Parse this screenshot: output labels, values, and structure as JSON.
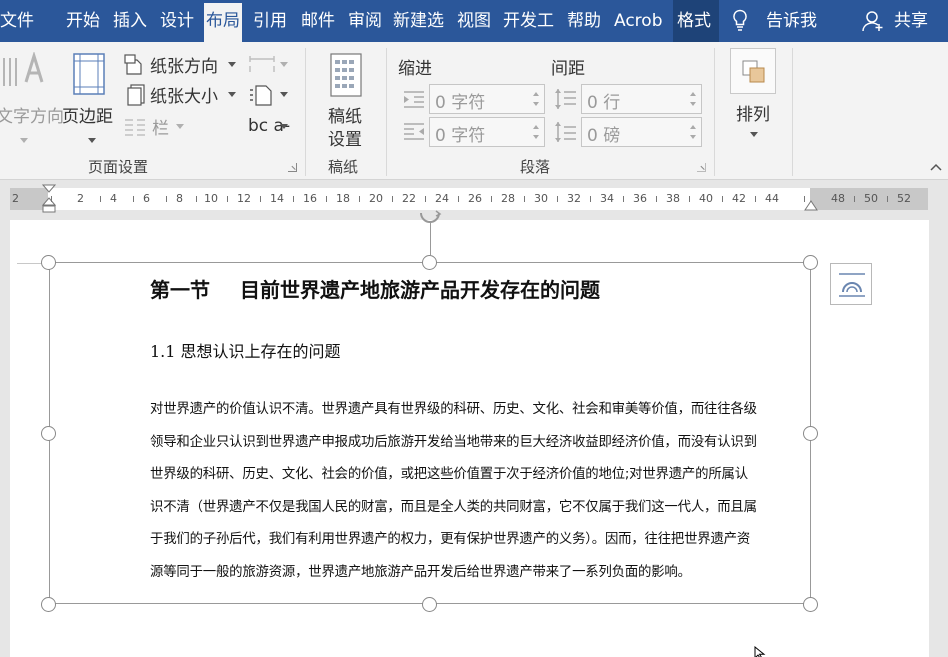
{
  "tabs": [
    {
      "label": "文件"
    },
    {
      "label": "开始"
    },
    {
      "label": "插入"
    },
    {
      "label": "设计"
    },
    {
      "label": "布局",
      "active": true
    },
    {
      "label": "引用"
    },
    {
      "label": "邮件"
    },
    {
      "label": "审阅"
    },
    {
      "label": "新建选"
    },
    {
      "label": "视图"
    },
    {
      "label": "开发工"
    },
    {
      "label": "帮助"
    },
    {
      "label": "Acrob"
    },
    {
      "label": "格式"
    }
  ],
  "tell_me": "告诉我",
  "share": "共享",
  "ribbon": {
    "page_setup": {
      "label": "页面设置",
      "text_direction": "文字方向",
      "margins": "页边距",
      "orientation": "纸张方向",
      "size": "纸张大小",
      "columns": "栏",
      "hyphenation_icon": "bc a-"
    },
    "draft": {
      "label": "稿纸",
      "button_line1": "稿纸",
      "button_line2": "设置"
    },
    "paragraph": {
      "label": "段落",
      "indent_title": "缩进",
      "spacing_title": "间距",
      "indent_left": "0 字符",
      "indent_right": "0 字符",
      "spacing_before": "0 行",
      "spacing_after": "0 磅"
    },
    "arrange": {
      "label": "排列"
    }
  },
  "ruler": {
    "numbers": [
      "2",
      "2",
      "4",
      "6",
      "8",
      "10",
      "12",
      "14",
      "16",
      "18",
      "20",
      "22",
      "24",
      "26",
      "28",
      "30",
      "32",
      "34",
      "36",
      "38",
      "40",
      "42",
      "44",
      "48",
      "50",
      "52"
    ]
  },
  "document": {
    "heading": {
      "part1": "第一节",
      "part2": "目前世界遗产地旅游产品开发存在的问题"
    },
    "subheading": "1.1  思想认识上存在的问题",
    "paragraph_lines": [
      "对世界遗产的价值认识不清。世界遗产具有世界级的科研、历史、文化、社会和审美等价值，而往往各级",
      "领导和企业只认识到世界遗产申报成功后旅游开发给当地带来的巨大经济收益即经济价值，而没有认识到",
      "世界级的科研、历史、文化、社会的价值，或把这些价值置于次于经济价值的地位;对世界遗产的所属认",
      "识不清（世界遗产不仅是我国人民的财富，而且是全人类的共同财富，它不仅属于我们这一代人，而且属",
      "于我们的子孙后代，我们有利用世界遗产的权力，更有保护世界遗产的义务）。因而，往往把世界遗产资",
      "源等同于一般的旅游资源，世界遗产地旅游产品开发后给世界遗产带来了一系列负面的影响。"
    ]
  },
  "colors": {
    "tabbar": "#2b579a",
    "ribbon": "#f3f3f3",
    "doc_background": "#e6e6e6"
  }
}
